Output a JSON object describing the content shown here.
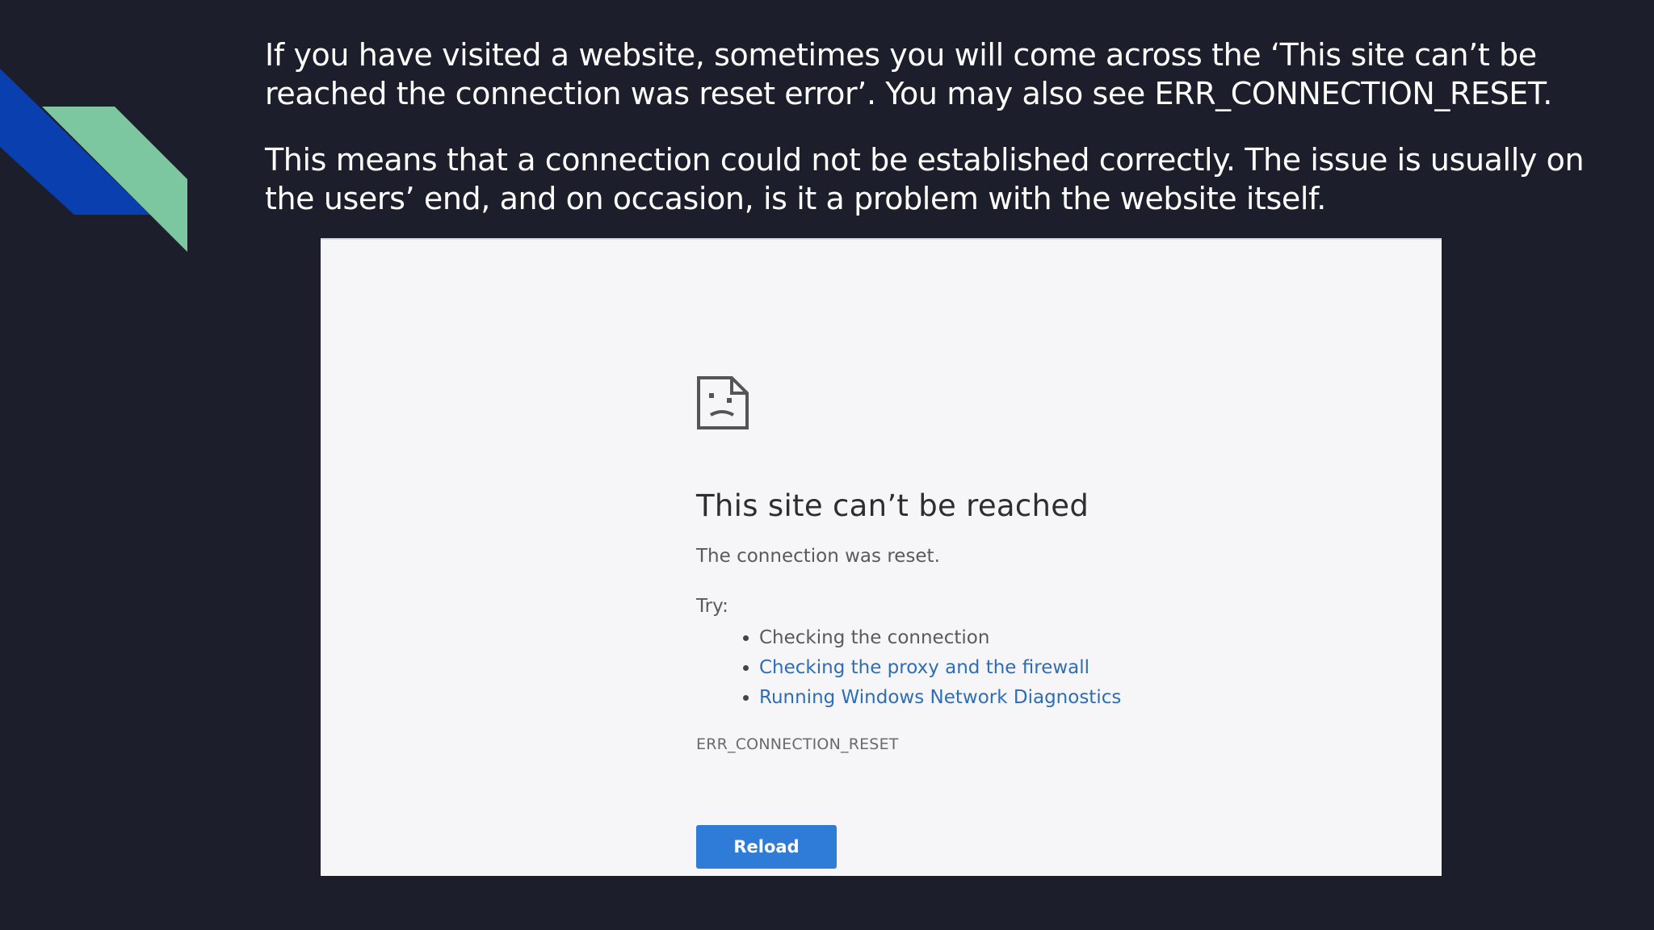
{
  "slide": {
    "paragraph_1": "If you have visited a website, sometimes you will come across the ‘This site can’t be reached the connection was reset error’. You may also see  ERR_CONNECTION_RESET.",
    "paragraph_2": "This means that a connection could not be established correctly. The issue is usually on the users’ end, and on occasion, is it a problem with the website itself.",
    "accent_colors": {
      "blue": "#0a3fb0",
      "green": "#7dc7a0"
    },
    "background": "#1c1f2b"
  },
  "error_page": {
    "icon": "sad-page-icon",
    "title": "This site can’t be reached",
    "subtitle": "The connection was reset.",
    "try_label": "Try:",
    "suggestions": [
      {
        "label": "Checking the connection",
        "is_link": false
      },
      {
        "label": "Checking the proxy and the firewall",
        "is_link": true
      },
      {
        "label": "Running Windows Network Diagnostics",
        "is_link": true
      }
    ],
    "error_code": "ERR_CONNECTION_RESET",
    "reload_label": "Reload",
    "colors": {
      "link": "#2f6db5",
      "button": "#2f7bd8",
      "page_bg": "#f6f6f8"
    }
  }
}
